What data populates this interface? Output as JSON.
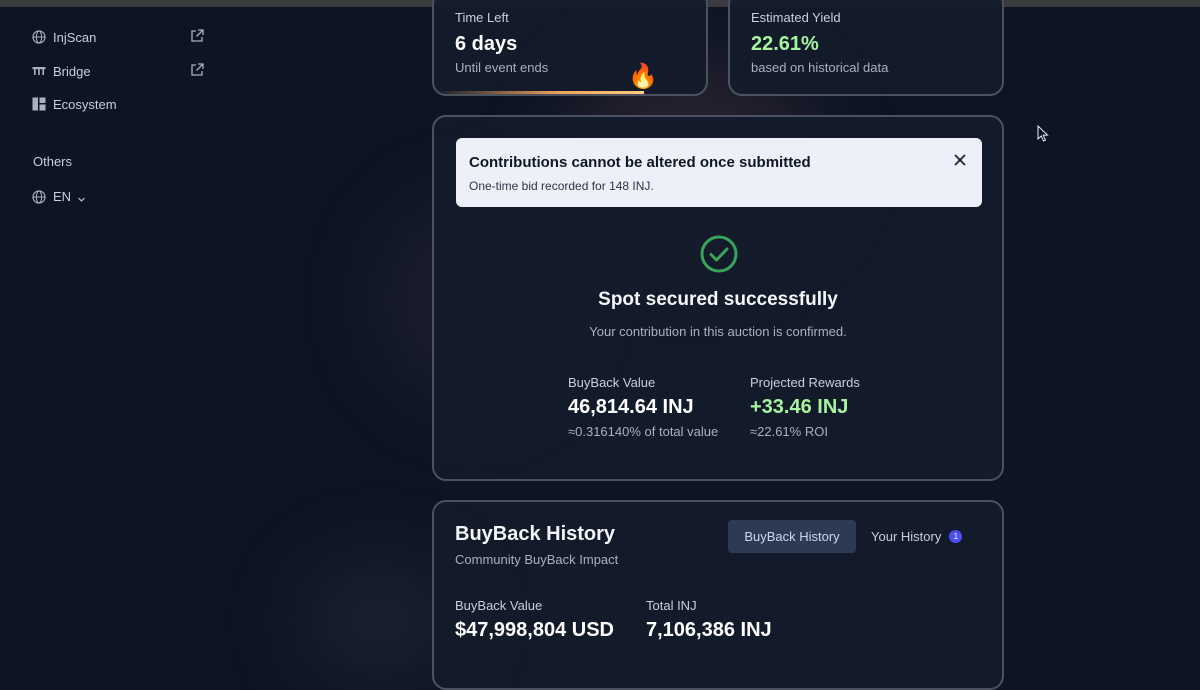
{
  "sidebar": {
    "items": [
      {
        "label": "InjScan",
        "icon": "globe-icon",
        "external": true
      },
      {
        "label": "Bridge",
        "icon": "bridge-icon",
        "external": true
      },
      {
        "label": "Ecosystem",
        "icon": "grid-icon",
        "external": false
      }
    ],
    "section_label": "Others",
    "language": "EN"
  },
  "time_card": {
    "label": "Time Left",
    "value": "6 days",
    "sub": "Until event ends"
  },
  "yield_card": {
    "label": "Estimated Yield",
    "value": "22.61%",
    "sub": "based on historical data"
  },
  "alert": {
    "title": "Contributions cannot be altered once submitted",
    "body": "One-time bid recorded for 148 INJ."
  },
  "success": {
    "title": "Spot secured successfully",
    "subtitle": "Your contribution in this auction is confirmed."
  },
  "metrics": {
    "buyback": {
      "label": "BuyBack Value",
      "value": "46,814.64 INJ",
      "sub": "≈0.316140% of total value"
    },
    "rewards": {
      "label": "Projected Rewards",
      "value": "+33.46 INJ",
      "sub": "≈22.61% ROI"
    }
  },
  "history": {
    "title": "BuyBack History",
    "subtitle": "Community BuyBack Impact",
    "tabs": [
      {
        "label": "BuyBack History",
        "active": true
      },
      {
        "label": "Your History",
        "active": false,
        "badge": "1"
      }
    ],
    "stats": [
      {
        "label": "BuyBack Value",
        "value": "$47,998,804 USD"
      },
      {
        "label": "Total INJ",
        "value": "7,106,386 INJ"
      }
    ]
  },
  "colors": {
    "background": "#0d1423",
    "accent_green": "#a6f4a0",
    "success_green": "#3aa35a",
    "badge": "#4b4ef0"
  }
}
